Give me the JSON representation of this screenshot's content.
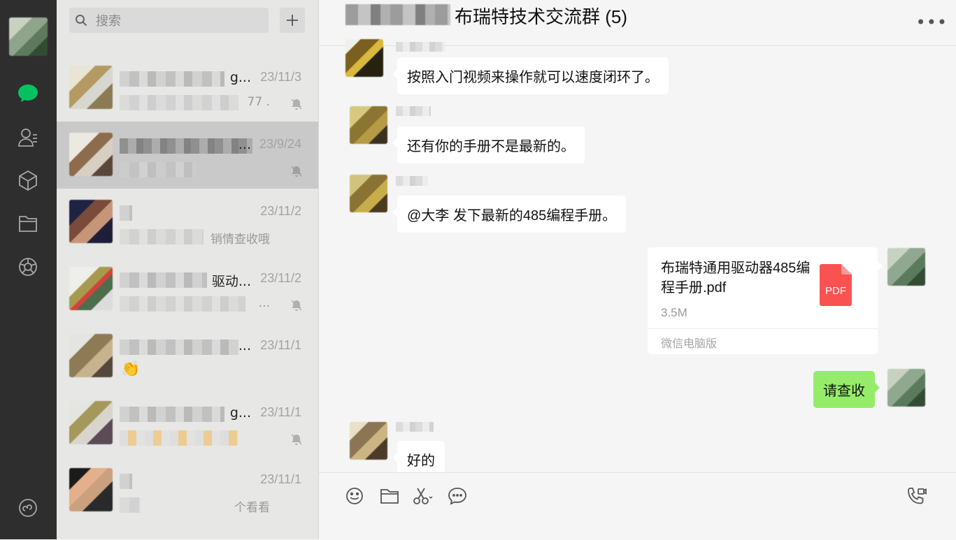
{
  "rail": {
    "icons": [
      "chat-icon",
      "contacts-icon",
      "favorites-icon",
      "files-icon",
      "moments-icon",
      "mini-programs-icon"
    ],
    "accent": "#07c160"
  },
  "search": {
    "placeholder": "搜索"
  },
  "sessions": [
    {
      "name": "g...",
      "time": "23/11/3",
      "preview": "77 .",
      "muted": true,
      "active": false
    },
    {
      "name": "...",
      "time": "23/9/24",
      "preview": "",
      "muted": true,
      "active": true
    },
    {
      "name": "",
      "time": "23/11/2",
      "preview": "销情查收哦",
      "muted": false,
      "active": false
    },
    {
      "name": "驱动...",
      "time": "23/11/2",
      "preview": "...",
      "muted": true,
      "active": false
    },
    {
      "name": "...",
      "time": "23/11/1",
      "preview": "",
      "muted": false,
      "active": false
    },
    {
      "name": "g...",
      "time": "23/11/1",
      "preview": "",
      "muted": true,
      "active": false
    },
    {
      "name": "",
      "time": "23/11/1",
      "preview": "个看看",
      "muted": false,
      "active": false
    }
  ],
  "chat": {
    "title": "布瑞特技术交流群 (5)",
    "messages": [
      {
        "side": "left",
        "text": "按照入门视频来操作就可以速度闭环了。"
      },
      {
        "side": "left",
        "text": "还有你的手册不是最新的。"
      },
      {
        "side": "left",
        "text": "@大李 发下最新的485编程手册。"
      },
      {
        "side": "right",
        "type": "file",
        "file_name": "布瑞特通用驱动器485编程手册.pdf",
        "file_size": "3.5M",
        "source": "微信电脑版",
        "file_badge": "PDF"
      },
      {
        "side": "right",
        "text": "请查收"
      },
      {
        "side": "left",
        "text": "好的"
      }
    ]
  },
  "composer": {
    "tools": [
      "emoji-icon",
      "folder-icon",
      "scissors-icon",
      "chat-history-icon"
    ],
    "call_icon": "voice-video-call-icon"
  },
  "colors": {
    "bubble_green": "#95ec69",
    "pdf_red": "#fa5151",
    "rail_bg": "#2e2e2e"
  }
}
